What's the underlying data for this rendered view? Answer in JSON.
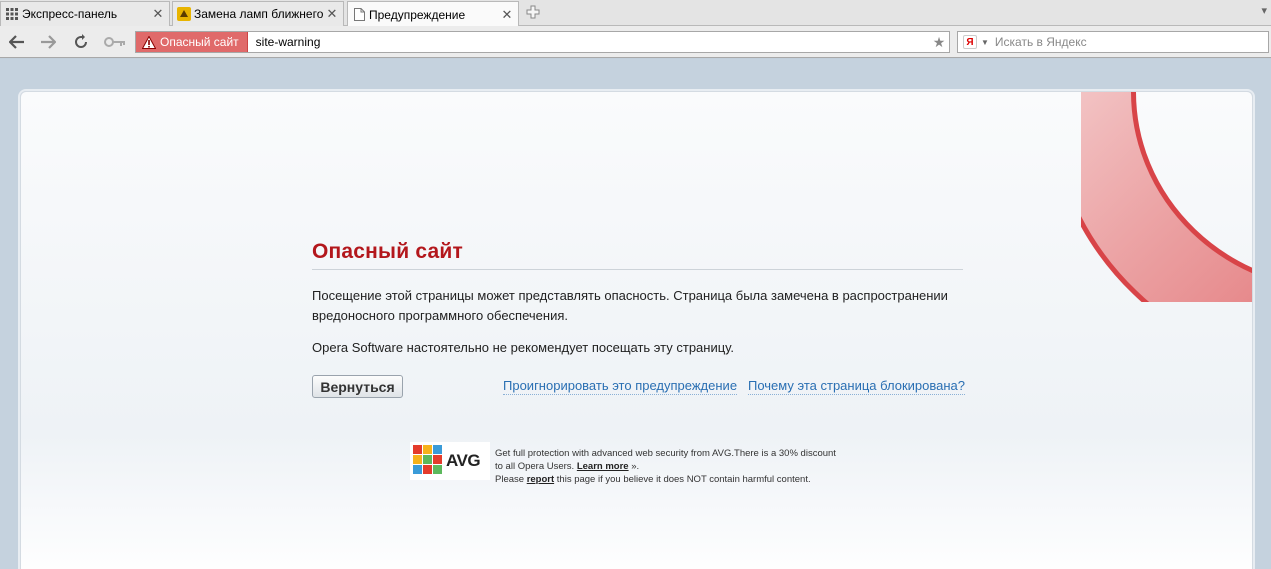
{
  "tabs": [
    {
      "label": "Экспресс-панель",
      "icon": "grid-icon",
      "active": false
    },
    {
      "label": "Замена ламп ближнего ...",
      "icon": "site-favicon-icon",
      "active": false
    },
    {
      "label": "Предупреждение",
      "icon": "page-icon",
      "active": true
    }
  ],
  "addressbar": {
    "danger_label": "Опасный сайт",
    "url": "site-warning",
    "search_placeholder": "Искать в Яндекс",
    "search_engine_letter": "Я"
  },
  "warning": {
    "title": "Опасный сайт",
    "message1": "Посещение этой страницы может представлять опасность. Страница была замечена в распространении вредоносного программного обеспечения.",
    "message2": "Opera Software настоятельно не рекомендует посещать эту страницу.",
    "back_button": "Вернуться",
    "ignore_link": "Проигнорировать это предупреждение",
    "why_link": "Почему эта страница блокирована?"
  },
  "avg": {
    "logo_text": "AVG",
    "line1": "Get full protection with advanced web security from AVG.There is a 30% discount",
    "line2_pre": "to all Opera Users. ",
    "learn_more": "Learn more",
    "line2_post": " ».",
    "line3_pre": "Please ",
    "report": "report",
    "line3_post": " this page if you believe it does NOT contain harmful content."
  },
  "colors": {
    "danger_red": "#b3171c",
    "link_blue": "#2a6fb3",
    "pill_red": "#e06a6a"
  }
}
